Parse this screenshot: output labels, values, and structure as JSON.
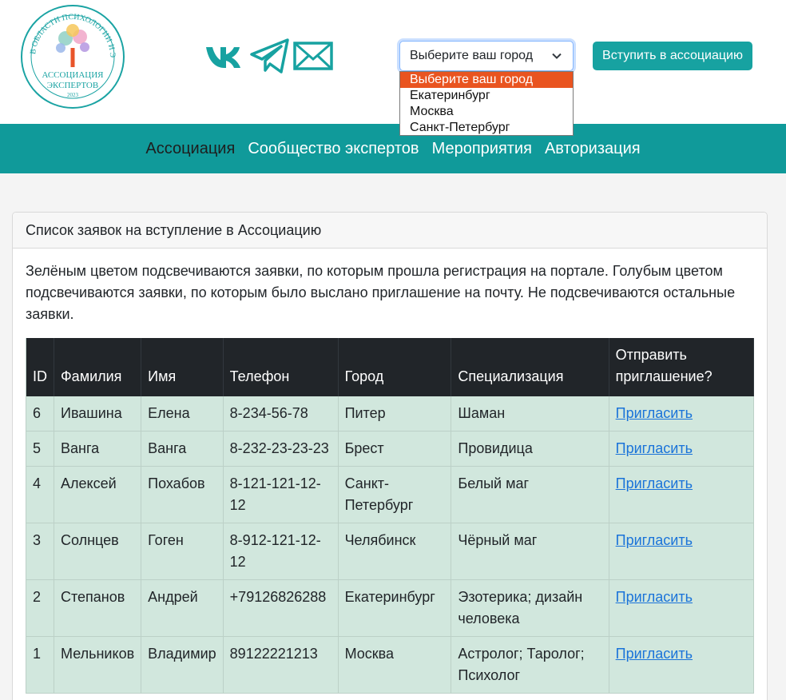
{
  "header": {
    "logo": {
      "ring_text": "В ОБЛАСТИ ПСИХОЛОГИИ И ЭЗОТЕРИКИ",
      "line1": "АССОЦИАЦИЯ",
      "line2": "ЭКСПЕРТОВ",
      "year": "2023"
    },
    "social": {
      "vk_icon": "vk-icon",
      "telegram_icon": "telegram-icon",
      "mail_icon": "mail-icon",
      "color": "#17a2a1"
    },
    "city_select": {
      "value": "Выберите ваш город",
      "options": [
        "Выберите ваш город",
        "Екатеринбург",
        "Москва",
        "Санкт-Петербург"
      ]
    },
    "join_button": "Вступить в ассоциацию"
  },
  "nav": {
    "items": [
      {
        "label": "Ассоциация",
        "active": true
      },
      {
        "label": "Сообщество экспертов",
        "active": false
      },
      {
        "label": "Мероприятия",
        "active": false
      },
      {
        "label": "Авторизация",
        "active": false
      }
    ]
  },
  "card": {
    "title": "Список заявок на вступление в Ассоциацию",
    "description": "Зелёным цветом подсвечиваются заявки, по которым прошла регистрация на портале. Голубым цветом подсвечиваются заявки, по которым было выслано приглашение на почту. Не подсвечиваются остальные заявки."
  },
  "table": {
    "columns": [
      "ID",
      "Фамилия",
      "Имя",
      "Телефон",
      "Город",
      "Специализация",
      "Отправить приглашение?"
    ],
    "rows": [
      {
        "id": "6",
        "surname": "Ивашина",
        "name": "Елена",
        "phone": "8-234-56-78",
        "city": "Питер",
        "spec": "Шаман",
        "action": "Пригласить"
      },
      {
        "id": "5",
        "surname": "Ванга",
        "name": "Ванга",
        "phone": "8-232-23-23-23",
        "city": "Брест",
        "spec": "Провидица",
        "action": "Пригласить"
      },
      {
        "id": "4",
        "surname": "Алексей",
        "name": "Похабов",
        "phone": "8-121-121-12-12",
        "city": "Санкт-Петербург",
        "spec": "Белый маг",
        "action": "Пригласить"
      },
      {
        "id": "3",
        "surname": "Солнцев",
        "name": "Гоген",
        "phone": "8-912-121-12-12",
        "city": "Челябинск",
        "spec": "Чёрный маг",
        "action": "Пригласить"
      },
      {
        "id": "2",
        "surname": "Степанов",
        "name": "Андрей",
        "phone": "+79126826288",
        "city": "Екатеринбург",
        "spec": "Эзотерика; дизайн человека",
        "action": "Пригласить"
      },
      {
        "id": "1",
        "surname": "Мельников",
        "name": "Владимир",
        "phone": "89122221213",
        "city": "Москва",
        "spec": "Астролог; Таролог; Психолог",
        "action": "Пригласить"
      }
    ],
    "row_color": "#d1e7dd",
    "header_color": "#212529"
  }
}
